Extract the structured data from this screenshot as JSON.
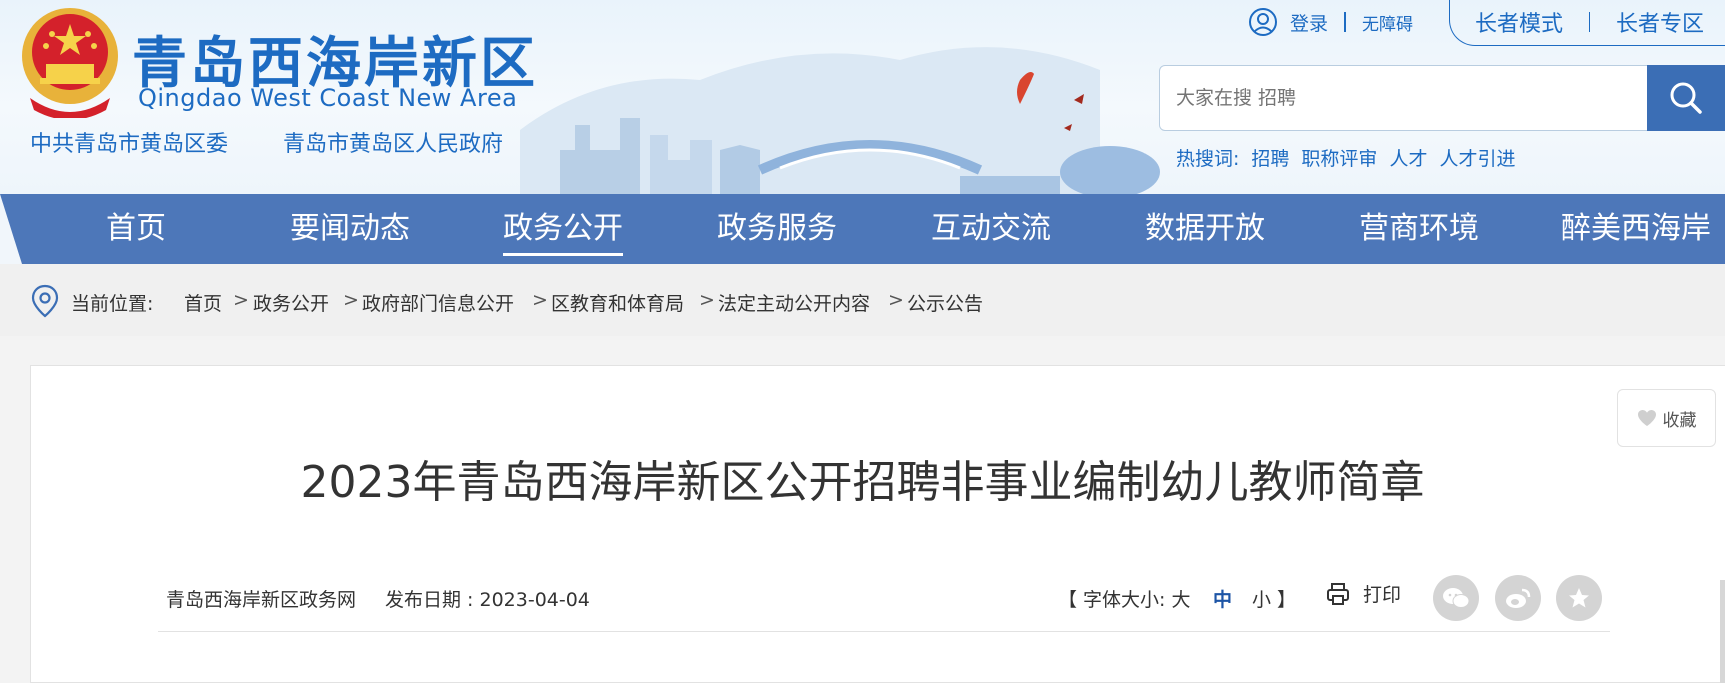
{
  "header": {
    "title": "青岛西海岸新区",
    "subtitle": "Qingdao West Coast New Area",
    "org_party": "中共青岛市黄岛区委",
    "org_gov": "青岛市黄岛区人民政府",
    "login": "登录",
    "accessibility": "无障碍",
    "elder_mode": "长者模式",
    "elder_zone": "长者专区",
    "search_placeholder": "大家在搜 招聘",
    "hot_label": "热搜词:",
    "hot_words": [
      "招聘",
      "职称评审",
      "人才",
      "人才引进"
    ]
  },
  "nav": {
    "items": [
      "首页",
      "要闻动态",
      "政务公开",
      "政务服务",
      "互动交流",
      "数据开放",
      "营商环境",
      "醉美西海岸"
    ],
    "active": "政务公开"
  },
  "breadcrumb": {
    "label": "当前位置:",
    "items": [
      "首页",
      "政务公开",
      "政府部门信息公开",
      "区教育和体育局",
      "法定主动公开内容",
      "公示公告"
    ]
  },
  "article": {
    "favorite": "收藏",
    "title": "2023年青岛西海岸新区公开招聘非事业编制幼儿教师简章",
    "source": "青岛西海岸新区政务网",
    "date_label": "发布日期 : 2023-04-04",
    "font_size_label": "【 字体大小: 大",
    "font_mid": "中",
    "font_small": "小 】",
    "print": "打印"
  },
  "colors": {
    "brand_blue": "#1d6bc2",
    "nav_blue": "#4d77b9",
    "search_btn": "#3b6eb5"
  },
  "icons": [
    "national-emblem-icon",
    "user-icon",
    "search-icon",
    "location-pin-icon",
    "heart-icon",
    "print-icon",
    "wechat-icon",
    "weibo-icon",
    "star-icon"
  ]
}
